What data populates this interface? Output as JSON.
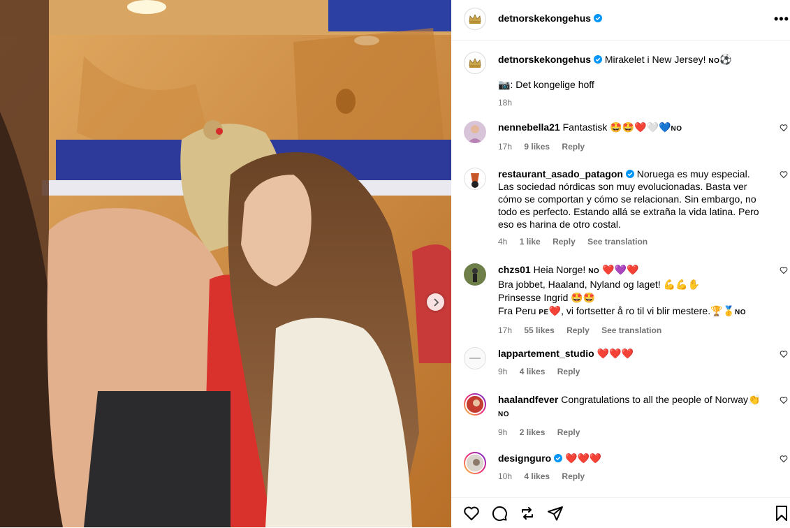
{
  "post": {
    "username": "detnorskekongehus",
    "more_label": "•••"
  },
  "caption": {
    "username": "detnorskekongehus",
    "text": "Mirakelet i New Jersey!",
    "flag": "NO",
    "emoji": "⚽",
    "credit_emoji": "📷",
    "credit": ": Det kongelige hoff",
    "time": "18h"
  },
  "comments": [
    {
      "username": "nennebella21",
      "text": "Fantastisk",
      "emoji": "🤩🤩❤️🤍💙",
      "flag": "NO",
      "time": "17h",
      "likes": "9 likes",
      "reply": "Reply",
      "translate": ""
    },
    {
      "username": "restaurant_asado_patagon",
      "text": "Noruega es muy especial. Las sociedad nórdicas son muy evolucionadas. Basta ver cómo se comportan y cómo se relacionan. Sin embargo, no todo es perfecto. Estando allá se extraña la vida latina. Pero eso es harina de otro costal.",
      "time": "4h",
      "likes": "1 like",
      "reply": "Reply",
      "translate": "See translation"
    },
    {
      "username": "chzs01",
      "line1": "Heia Norge!",
      "line1_flag": "NO",
      "line1_emoji": "❤️💜❤️",
      "line2": "Bra jobbet, Haaland, Nyland og laget!",
      "line2_emoji": "💪💪✋",
      "line3": "Prinsesse Ingrid",
      "line3_emoji": "🤩🤩",
      "line4_a": "Fra Peru",
      "line4_flag": "PE",
      "line4_heart": "❤️",
      "line4_b": ", vi fortsetter å ro til vi blir mestere.",
      "line4_emoji": "🏆🥇",
      "line4_flag2": "NO",
      "time": "17h",
      "likes": "55 likes",
      "reply": "Reply",
      "translate": "See translation"
    },
    {
      "username": "lappartement_studio",
      "emoji": "❤️❤️❤️",
      "time": "9h",
      "likes": "4 likes",
      "reply": "Reply"
    },
    {
      "username": "haalandfever",
      "text": "Congratulations to all the people of Norway",
      "emoji": "👏",
      "flag": "NO",
      "time": "9h",
      "likes": "2 likes",
      "reply": "Reply"
    },
    {
      "username": "designguro",
      "emoji": "❤️❤️❤️",
      "time": "10h",
      "likes": "4 likes",
      "reply": "Reply"
    }
  ],
  "icons": [
    "heart-icon",
    "comment-icon",
    "repost-icon",
    "share-icon",
    "bookmark-icon",
    "verified-icon",
    "chevron-right-icon",
    "more-icon"
  ],
  "colors": {
    "verified": "#0095f6",
    "meta_text": "#737373",
    "link": "#00376b"
  }
}
